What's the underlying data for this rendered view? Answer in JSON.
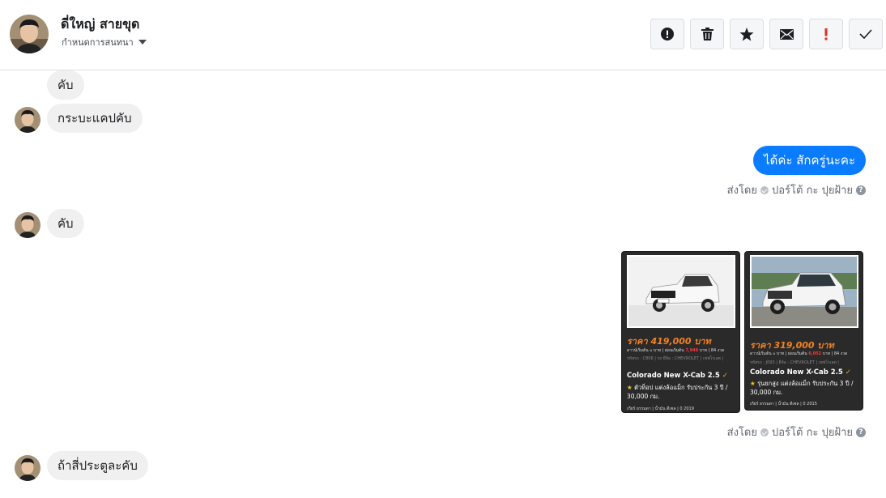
{
  "header": {
    "contact_name": "ดี่ใหญ่ สายขุด",
    "assign_label": "กำหนดการสนทนา",
    "toolbar": [
      {
        "name": "spam-button",
        "icon": "alert-circle-icon"
      },
      {
        "name": "delete-button",
        "icon": "trash-icon"
      },
      {
        "name": "star-button",
        "icon": "star-icon"
      },
      {
        "name": "mark-unread-button",
        "icon": "envelope-icon"
      },
      {
        "name": "follow-up-button",
        "icon": "exclamation-icon"
      },
      {
        "name": "mark-done-button",
        "icon": "check-icon"
      }
    ]
  },
  "messages": {
    "m1": "คับ",
    "m2": "กระบะแคปคับ",
    "m3": "ได้ค่ะ สักครู่นะคะ",
    "m4": "คับ",
    "m5": "ถ้าสี่ประตูละคับ"
  },
  "sent_by": {
    "prefix": "ส่งโดย",
    "agent": "ปอร์โต้ กะ ปุยฝ้าย",
    "help": "?"
  },
  "cards": [
    {
      "price": "ราคา 419,000 บาท",
      "finance_prefix": "ดาวน์เริ่มต้น ๐ บาท | ผ่อนเริ่มต้น ",
      "finance_highlight": "7,949",
      "finance_suffix": " บาท | 84 งวด",
      "tags": "รหัสรถ : C806 | รถ ยี่ห้อ : CHEVROLET | เชฟโรเลต |",
      "model": "Colorado New X-Cab 2.5",
      "desc": "ตัวท็อป แต่งล้อแม็ก รับประกัน 3 ปี / 30,000 กม.",
      "footer": "เกียร์ ธรรมดา | น้ำมัน ดีเซล | 0 2019"
    },
    {
      "price": "ราคา 319,000 บาท",
      "finance_prefix": "ดาวน์เริ่มต้น ๐ บาท | ผ่อนเริ่มต้น ",
      "finance_highlight": "6,052",
      "finance_suffix": " บาท | 84 งวด",
      "tags": "รหัสรถ : J093 | ยี่ห้อ : CHEVROLET | เชฟโรเลต |",
      "model": "Colorado New X-Cab 2.5",
      "desc": "รุ่นยกสูง แต่งล้อแม็ก รับประกัน 3 ปี / 30,000 กม.",
      "footer": "เกียร์ ธรรมดา | น้ำมัน ดีเซล | 0 2015"
    }
  ],
  "colors": {
    "outgoing_bubble": "#0a7cff",
    "incoming_bubble": "#f0f0f0",
    "price": "#f58220",
    "follow_up": "#e0301e"
  }
}
